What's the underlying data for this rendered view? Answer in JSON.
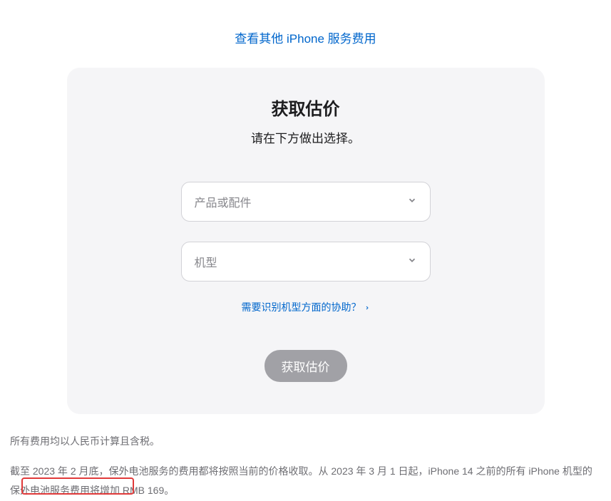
{
  "topLink": {
    "label": "查看其他 iPhone 服务费用"
  },
  "card": {
    "title": "获取估价",
    "subtitle": "请在下方做出选择。",
    "dropdown1": {
      "placeholder": "产品或配件"
    },
    "dropdown2": {
      "placeholder": "机型"
    },
    "helpLink": {
      "label": "需要识别机型方面的协助？"
    },
    "button": {
      "label": "获取估价"
    }
  },
  "footer": {
    "line1": "所有费用均以人民币计算且含税。",
    "line2": "截至 2023 年 2 月底，保外电池服务的费用都将按照当前的价格收取。从 2023 年 3 月 1 日起，iPhone 14 之前的所有 iPhone 机型的保外电池服务费用将增加 RMB 169。"
  }
}
